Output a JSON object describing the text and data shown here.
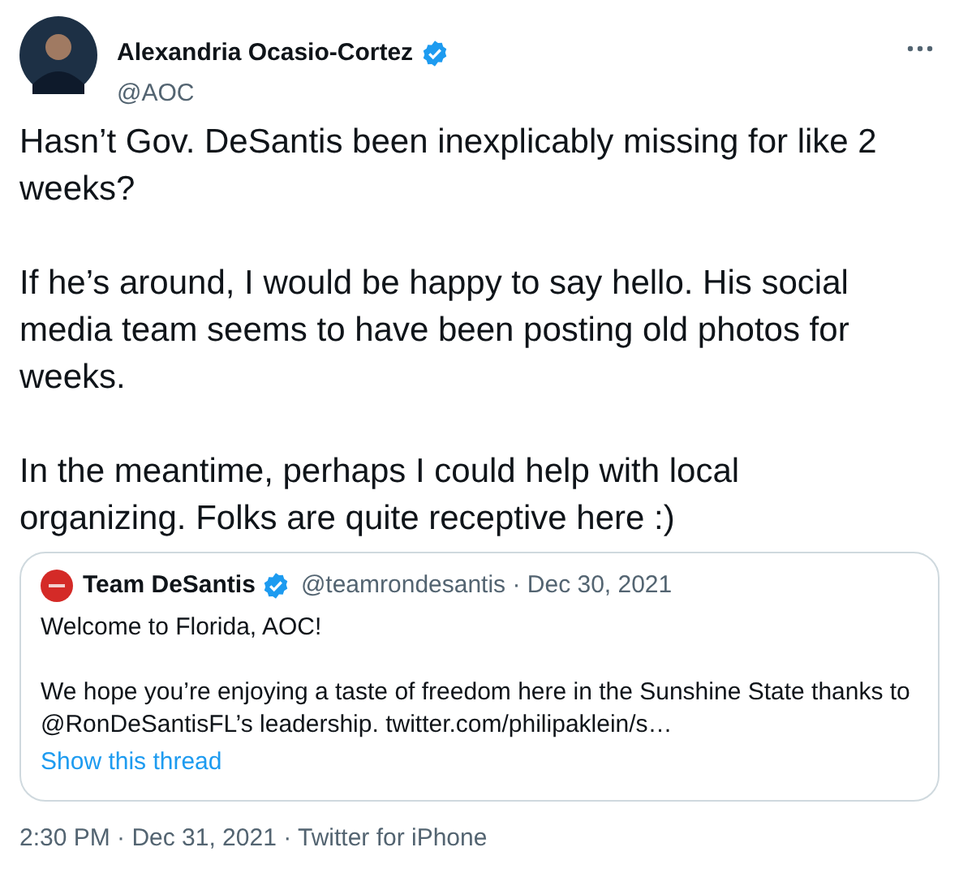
{
  "author": {
    "name": "Alexandria Ocasio-Cortez",
    "verified": true,
    "handle": "@AOC"
  },
  "text": [
    "Hasn’t Gov. DeSantis been inexplicably missing for like 2 weeks?",
    "If he’s around, I would be happy to say hello. His social media team seems to have been posting old photos for weeks.",
    "In the meantime, perhaps I could help with local organizing. Folks are quite receptive here :)"
  ],
  "quoted_tweet": {
    "name": "Team DeSantis",
    "verified": true,
    "handle_date": "@teamrondesantis · Dec 30, 2021",
    "text": [
      "Welcome to Florida, AOC!",
      "We hope you’re enjoying a taste of freedom here in the Sunshine State thanks to @RonDeSantisFL’s leadership. twitter.com/philipaklein/s…"
    ],
    "thread_link": "Show this thread"
  },
  "footer": "2:30 PM · Dec 31, 2021 · Twitter for iPhone"
}
